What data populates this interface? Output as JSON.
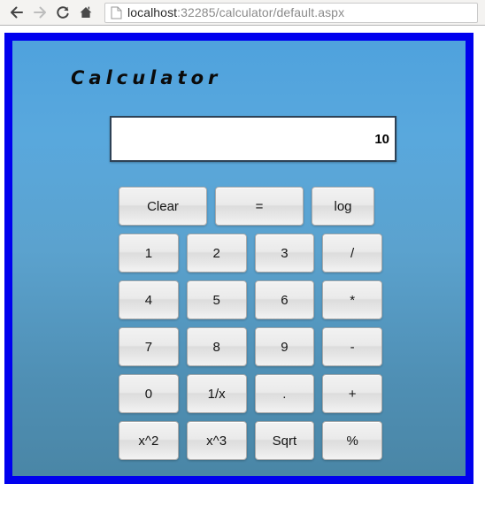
{
  "browser": {
    "nav": [
      {
        "name": "back-button",
        "icon": "back-arrow-icon",
        "enabled": true
      },
      {
        "name": "forward-button",
        "icon": "forward-arrow-icon",
        "enabled": false
      },
      {
        "name": "reload-button",
        "icon": "reload-icon",
        "enabled": true
      },
      {
        "name": "home-button",
        "icon": "home-icon",
        "enabled": true
      }
    ],
    "address_bar": {
      "icon": "page-document-icon",
      "host": "localhost",
      "path": ":32285/calculator/default.aspx",
      "full_url": "localhost:32285/calculator/default.aspx"
    }
  },
  "page": {
    "title": "Calculator",
    "border_color": "#0000ee",
    "background_top": "#4fa2dd",
    "background_bottom": "#4a86a6"
  },
  "display": {
    "value": "10",
    "placeholder": ""
  },
  "keypad": {
    "rows": [
      [
        {
          "label": "Clear",
          "name": "clear-button",
          "size": "w-clear"
        },
        {
          "label": "=",
          "name": "equals-button",
          "size": "w-equals"
        },
        {
          "label": "log",
          "name": "log-button",
          "size": "w-log"
        }
      ],
      [
        {
          "label": "1",
          "name": "digit-1-button",
          "size": "w-grid"
        },
        {
          "label": "2",
          "name": "digit-2-button",
          "size": "w-grid"
        },
        {
          "label": "3",
          "name": "digit-3-button",
          "size": "w-grid"
        },
        {
          "label": "/",
          "name": "divide-button",
          "size": "w-grid"
        }
      ],
      [
        {
          "label": "4",
          "name": "digit-4-button",
          "size": "w-grid"
        },
        {
          "label": "5",
          "name": "digit-5-button",
          "size": "w-grid"
        },
        {
          "label": "6",
          "name": "digit-6-button",
          "size": "w-grid"
        },
        {
          "label": "*",
          "name": "multiply-button",
          "size": "w-grid"
        }
      ],
      [
        {
          "label": "7",
          "name": "digit-7-button",
          "size": "w-grid"
        },
        {
          "label": "8",
          "name": "digit-8-button",
          "size": "w-grid"
        },
        {
          "label": "9",
          "name": "digit-9-button",
          "size": "w-grid"
        },
        {
          "label": "-",
          "name": "subtract-button",
          "size": "w-grid"
        }
      ],
      [
        {
          "label": "0",
          "name": "digit-0-button",
          "size": "w-grid"
        },
        {
          "label": "1/x",
          "name": "reciprocal-button",
          "size": "w-grid"
        },
        {
          "label": ".",
          "name": "decimal-button",
          "size": "w-grid"
        },
        {
          "label": "+",
          "name": "add-button",
          "size": "w-grid"
        }
      ],
      [
        {
          "label": "x^2",
          "name": "square-button",
          "size": "w-grid"
        },
        {
          "label": "x^3",
          "name": "cube-button",
          "size": "w-grid"
        },
        {
          "label": "Sqrt",
          "name": "square-root-button",
          "size": "w-grid"
        },
        {
          "label": "%",
          "name": "percent-button",
          "size": "w-grid"
        }
      ]
    ]
  }
}
